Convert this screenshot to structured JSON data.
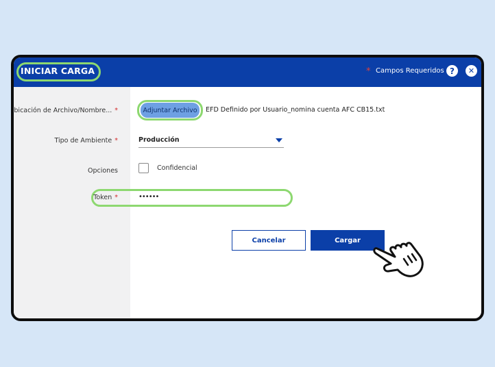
{
  "dialog": {
    "title": "INICIAR CARGA",
    "required_star": "*",
    "required_text": "Campos Requeridos",
    "help_icon": "?",
    "close_icon": "✕"
  },
  "form": {
    "file": {
      "label": "Ubicación de Archivo/Nombre...",
      "star": "*",
      "button_label": "Adjuntar Archivo",
      "file_name": "EFD Definido por Usuario_nomina cuenta AFC CB15.txt"
    },
    "environment": {
      "label": "Tipo de Ambiente",
      "star": "*",
      "value": "Producción"
    },
    "options": {
      "label": "Opciones",
      "checkbox_label": "Confidencial",
      "checked": false
    },
    "token": {
      "label": "Token",
      "star": "*",
      "value": "••••••"
    }
  },
  "actions": {
    "cancel_label": "Cancelar",
    "submit_label": "Cargar"
  },
  "colors": {
    "header": "#0b3fa8",
    "highlight": "#8dd870",
    "required": "#d42b2b"
  }
}
